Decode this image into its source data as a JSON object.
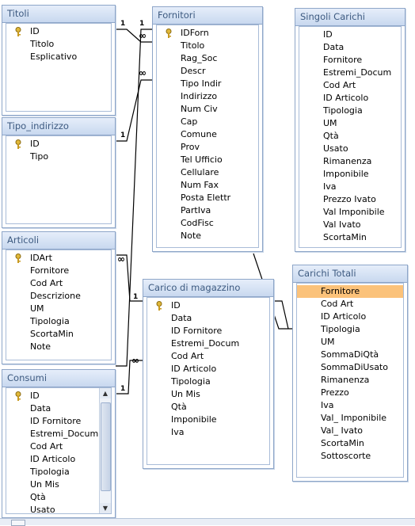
{
  "tables": {
    "titoli": {
      "title": "Titoli",
      "fields": [
        "ID",
        "Titolo",
        "Esplicativo"
      ],
      "key_field": 0
    },
    "tipo_indirizzo": {
      "title": "Tipo_indirizzo",
      "fields": [
        "ID",
        "Tipo"
      ],
      "key_field": 0
    },
    "articoli": {
      "title": "Articoli",
      "fields": [
        "IDArt",
        "Fornitore",
        "Cod Art",
        "Descrizione",
        "UM",
        "Tipologia",
        "ScortaMin",
        "Note"
      ],
      "key_field": 0
    },
    "consumi": {
      "title": "Consumi",
      "fields": [
        "ID",
        "Data",
        "ID Fornitore",
        "Estremi_Docum",
        "Cod Art",
        "ID Articolo",
        "Tipologia",
        "Un Mis",
        "Qtà",
        "Usato"
      ],
      "key_field": 0
    },
    "fornitori": {
      "title": "Fornitori",
      "fields": [
        "IDForn",
        "Titolo",
        "Rag_Soc",
        "Descr",
        "Tipo Indir",
        "Indirizzo",
        "Num Civ",
        "Cap",
        "Comune",
        "Prov",
        "Tel Ufficio",
        "Cellulare",
        "Num Fax",
        "Posta Elettr",
        "PartIva",
        "CodFisc",
        "Note"
      ],
      "key_field": 0
    },
    "carico_magazzino": {
      "title": "Carico di magazzino",
      "fields": [
        "ID",
        "Data",
        "ID Fornitore",
        "Estremi_Docum",
        "Cod Art",
        "ID Articolo",
        "Tipologia",
        "Un Mis",
        "Qtà",
        "Imponibile",
        "Iva"
      ],
      "key_field": 0
    },
    "singoli_carichi": {
      "title": "Singoli Carichi",
      "fields": [
        "ID",
        "Data",
        "Fornitore",
        "Estremi_Docum",
        "Cod Art",
        "ID Articolo",
        "Tipologia",
        "UM",
        "Qtà",
        "Usato",
        "Rimanenza",
        "Imponibile",
        "Iva",
        "Prezzo Ivato",
        "Val Imponibile",
        "Val Ivato",
        "ScortaMin"
      ]
    },
    "carichi_totali": {
      "title": "Carichi Totali",
      "fields": [
        "Fornitore",
        "Cod Art",
        "ID Articolo",
        "Tipologia",
        "UM",
        "SommaDiQtà",
        "SommaDiUsato",
        "Rimanenza",
        "Prezzo",
        "Iva",
        "Val_ Imponibile",
        "Val_ Ivato",
        "ScortaMin",
        "Sottoscorte"
      ],
      "highlighted_field": 0
    }
  },
  "relationships": {
    "one_symbol": "1",
    "many_symbol": "∞"
  },
  "colors": {
    "header_text": "#3d5a80",
    "border": "#8ea6c8",
    "highlight": "#fbc27a"
  }
}
